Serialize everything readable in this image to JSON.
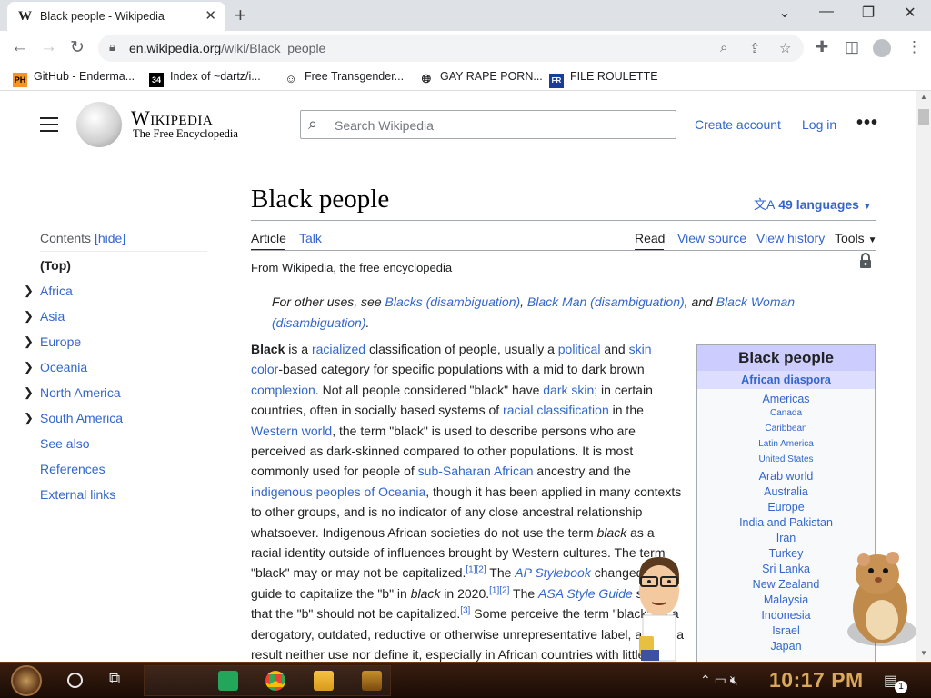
{
  "browser": {
    "tab_title": "Black people - Wikipedia",
    "tab_favicon": "W",
    "url_host": "en.wikipedia.org",
    "url_path": "/wiki/Black_people",
    "bookmarks": [
      {
        "label": "GitHub - Enderma...",
        "icon": "PH",
        "icon_color": "#f7931e"
      },
      {
        "label": "Index of ~dartz/i...",
        "icon": "34",
        "icon_color": "#000000"
      },
      {
        "label": "Free Transgender...",
        "icon": "mask-icon",
        "icon_color": "#5f6368"
      },
      {
        "label": "GAY RAPE PORN...",
        "icon": "globe-icon",
        "icon_color": "#5f6368"
      },
      {
        "label": "FILE ROULETTE",
        "icon": "FR",
        "icon_color": "#1a3d9c"
      }
    ]
  },
  "wiki": {
    "wordmark": "Wikipedia",
    "tagline": "The Free Encyclopedia",
    "search_placeholder": "Search Wikipedia",
    "create_account": "Create account",
    "log_in": "Log in",
    "more": "•••",
    "contents_label": "Contents",
    "contents_hide": "[hide]",
    "toc_top": "(Top)",
    "toc": [
      {
        "label": "Africa",
        "expandable": true
      },
      {
        "label": "Asia",
        "expandable": true
      },
      {
        "label": "Europe",
        "expandable": true
      },
      {
        "label": "Oceania",
        "expandable": true
      },
      {
        "label": "North America",
        "expandable": true
      },
      {
        "label": "South America",
        "expandable": true
      },
      {
        "label": "See also",
        "expandable": false
      },
      {
        "label": "References",
        "expandable": false
      },
      {
        "label": "External links",
        "expandable": false
      }
    ],
    "title": "Black people",
    "languages": "49 languages",
    "tab_article": "Article",
    "tab_talk": "Talk",
    "tab_read": "Read",
    "tab_view_source": "View source",
    "tab_view_history": "View history",
    "tab_tools": "Tools",
    "from_line": "From Wikipedia, the free encyclopedia",
    "hatnote": {
      "prefix": "For other uses, see ",
      "link1": "Blacks (disambiguation)",
      "sep1": ", ",
      "link2": "Black Man (disambiguation)",
      "sep2": ", and ",
      "link3": "Black Woman (disambiguation)",
      "suffix": "."
    },
    "infobox": {
      "title": "Black people",
      "subtitle": "African diaspora",
      "items": [
        {
          "label": "Americas",
          "size": "large"
        },
        {
          "label": "Canada",
          "size": "small"
        },
        {
          "label": "Caribbean",
          "size": "small"
        },
        {
          "label": "Latin America",
          "size": "small"
        },
        {
          "label": "United States",
          "size": "small"
        },
        {
          "label": "Arab world",
          "size": "large"
        },
        {
          "label": "Australia",
          "size": "large"
        },
        {
          "label": "Europe",
          "size": "large"
        },
        {
          "label": "India and Pakistan",
          "size": "large"
        },
        {
          "label": "Iran",
          "size": "large"
        },
        {
          "label": "Turkey",
          "size": "large"
        },
        {
          "label": "Sri Lanka",
          "size": "large"
        },
        {
          "label": "New Zealand",
          "size": "large"
        },
        {
          "label": "Malaysia",
          "size": "large"
        },
        {
          "label": "Indonesia",
          "size": "large"
        },
        {
          "label": "Israel",
          "size": "large"
        },
        {
          "label": "Japan",
          "size": "large"
        }
      ]
    },
    "body": {
      "s1_bold": "Black",
      "s1_a": " is a ",
      "l_racialized": "racialized",
      "s1_b": " classification of people, usually a ",
      "l_political": "political",
      "s1_c": " and ",
      "l_skin_color": "skin color",
      "s1_d": "-based category for specific populations with a mid to dark brown ",
      "l_complexion": "complexion",
      "s1_e": ". Not all people considered \"black\" have ",
      "l_dark_skin": "dark skin",
      "s1_f": "; in certain countries, often in socially based systems of ",
      "l_racial_class": "racial classification",
      "s1_g": " in the ",
      "l_western_world": "Western world",
      "s1_h": ", the term \"black\" is used to describe persons who are perceived as dark-skinned compared to other populations. It is most commonly used for people of ",
      "l_subsaharan": "sub-Saharan African",
      "s1_i": " ancestry and the ",
      "l_indigenous": "indigenous peoples of Oceania",
      "s1_j": ", though it has been applied in many contexts to other groups, and is no indicator of any close ancestral relationship whatsoever. Indigenous African societies do not use the term ",
      "i_black1": "black",
      "s1_k": " as a racial identity outside of influences brought by Western cultures. The term \"black\" may or may not be capitalized.",
      "ref12a": "[1][2]",
      "s1_l": " The ",
      "l_ap": "AP Stylebook",
      "s1_m": " changed its guide to capitalize the \"b\" in ",
      "i_black2": "black",
      "s1_n": " in 2020.",
      "ref12b": "[1][2]",
      "s1_o": " The ",
      "l_asa": "ASA Style Guide",
      "s1_p": " says that the \"b\" should not be capitalized.",
      "ref3": "[3]",
      "s1_q": " Some perceive the term \"black\" as a derogatory, outdated, reductive or otherwise unrepresentative label, and as a result neither use nor define it, especially in African countries with little to no"
    }
  },
  "taskbar": {
    "clock": "10:17 PM",
    "notification_count": "1"
  }
}
